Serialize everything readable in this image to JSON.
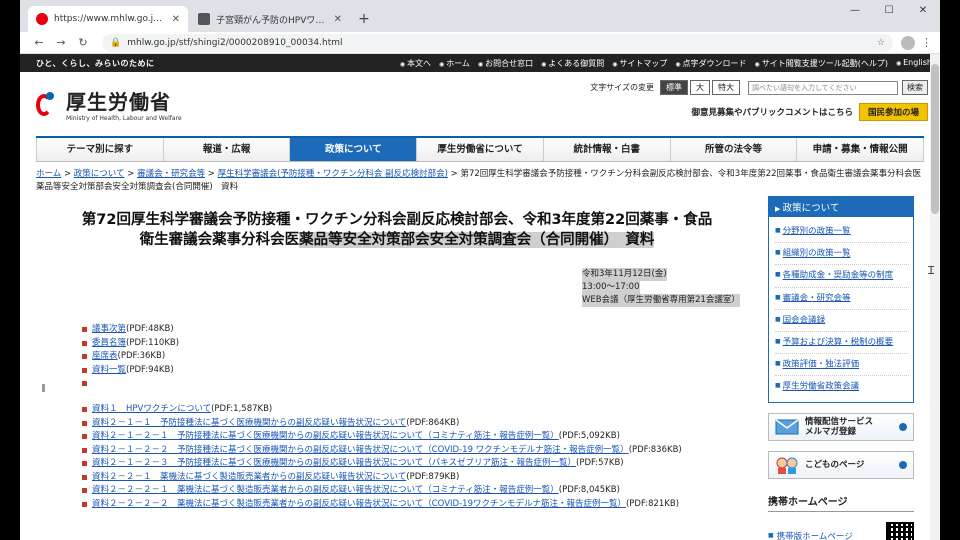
{
  "browser": {
    "tabs": [
      {
        "title": "https://www.mhlw.go.jp/stf/shingi",
        "active": true,
        "favicon_color": "#e60012"
      },
      {
        "title": "子宮頸がん予防のHPVワクチン「積極」",
        "active": false,
        "favicon_color": "#555555"
      }
    ],
    "new_tab": "+",
    "window_controls": [
      "—",
      "☐",
      "✕"
    ],
    "url": "mhlw.go.jp/stf/shingi2/0000208910_00034.html",
    "nav": {
      "back": "←",
      "forward": "→",
      "reload": "↻"
    },
    "star": "☆",
    "menu": "⋮"
  },
  "site": {
    "tagline": "ひと、くらし、みらいのために",
    "top_links": [
      "本文へ",
      "ホーム",
      "お問合せ窓口",
      "よくある御質問",
      "サイトマップ",
      "点字ダウンロード",
      "サイト閲覧支援ツール起動(ヘルプ)",
      "English"
    ],
    "logo_jp": "厚生労働省",
    "logo_en": "Ministry of Health, Labour and Welfare",
    "font_size_label": "文字サイズの変更",
    "font_sizes": [
      "標準",
      "大",
      "特大"
    ],
    "search_placeholder": "調べたい語句を入力してください",
    "search_button": "検索",
    "opinion_text": "御意見募集やパブリックコメントはこちら",
    "kokumin_button": "国民参加の場",
    "brand_red": "#e60012",
    "brand_blue": "#1d6bb8"
  },
  "gnav": [
    {
      "label": "テーマ別に探す",
      "active": false
    },
    {
      "label": "報道・広報",
      "active": false
    },
    {
      "label": "政策について",
      "active": true
    },
    {
      "label": "厚生労働省について",
      "active": false
    },
    {
      "label": "統計情報・白書",
      "active": false
    },
    {
      "label": "所管の法令等",
      "active": false
    },
    {
      "label": "申請・募集・情報公開",
      "active": false
    }
  ],
  "breadcrumb": {
    "links": [
      "ホーム",
      "政策について",
      "審議会・研究会等",
      "厚生科学審議会(予防接種・ワクチン分科会 副反応検討部会)"
    ],
    "current": "第72回厚生科学審議会予防接種・ワクチン分科会副反応検討部会、令和3年度第22回薬事・食品衛生審議会薬事分科会医薬品等安全対策部会安全対策調査会(合同開催)　資料"
  },
  "doc": {
    "title_line1": "第72回厚生科学審議会予防接種・ワクチン分科会副反応検討部会、令和3年度第22回薬事・食品",
    "title_line2_plain": "衛生審議会薬事分科会医",
    "title_line2_highlight": "薬品等安全対策部会安全対策調査会（合同開催）　資料",
    "date": "令和3年11月12日(金)",
    "time": "13:00～17:00",
    "place": "WEB会議（厚生労働省専用第21会議室）"
  },
  "files_group1": [
    {
      "label": "議事次第",
      "size": "(PDF:48KB)"
    },
    {
      "label": "委員名簿",
      "size": "(PDF:110KB)"
    },
    {
      "label": "座席表",
      "size": "(PDF:36KB)"
    },
    {
      "label": "資料一覧",
      "size": "(PDF:94KB)"
    }
  ],
  "files_group2": [
    {
      "label": "資料１　HPVワクチンについて",
      "size": "(PDF:1,587KB)"
    },
    {
      "label": "資料２－１－１　予防接種法に基づく医療機関からの副反応疑い報告状況について",
      "size": "(PDF:864KB)"
    },
    {
      "label": "資料２－１－２－１　予防接種法に基づく医療機関からの副反応疑い報告状況について（コミナティ筋注・報告症例一覧）",
      "size": "(PDF:5,092KB)"
    },
    {
      "label": "資料２－１－２－２　予防接種法に基づく医療機関からの副反応疑い報告状況について（COVID-19 ワクチンモデルナ筋注・報告症例一覧）",
      "size": "(PDF:836KB)"
    },
    {
      "label": "資料２－１－２－３　予防接種法に基づく医療機関からの副反応疑い報告状況について（バキスゼブリア筋注・報告症例一覧）",
      "size": "(PDF:57KB)"
    },
    {
      "label": "資料２－２－１　薬機法に基づく製造販売業者からの副反応疑い報告状況について",
      "size": "(PDF:879KB)"
    },
    {
      "label": "資料２－２－２－１　薬機法に基づく製造販売業者からの副反応疑い報告状況について（コミナティ筋注・報告症例一覧）",
      "size": "(PDF:8,045KB)"
    },
    {
      "label": "資料２－２－２－２　薬機法に基づく製造販売業者からの副反応疑い報告状況について（COVID-19ワクチンモデルナ筋注・報告症例一覧）",
      "size": "(PDF:821KB)"
    }
  ],
  "sidebar": {
    "head": "政策について",
    "items": [
      "分野別の政策一覧",
      "組織別の政策一覧",
      "各種助成金・奨励金等の制度",
      "審議会・研究会等",
      "国会会議録",
      "予算および決算・税制の概要",
      "政策評価・独法評価",
      "厚生労働省政策会議"
    ],
    "banner1_line1": "情報配信サービス",
    "banner1_line2": "メルマガ登録",
    "banner2": "こどものページ",
    "mobile_head": "携帯ホームページ",
    "mobile_link": "携帯版ホームページ"
  }
}
